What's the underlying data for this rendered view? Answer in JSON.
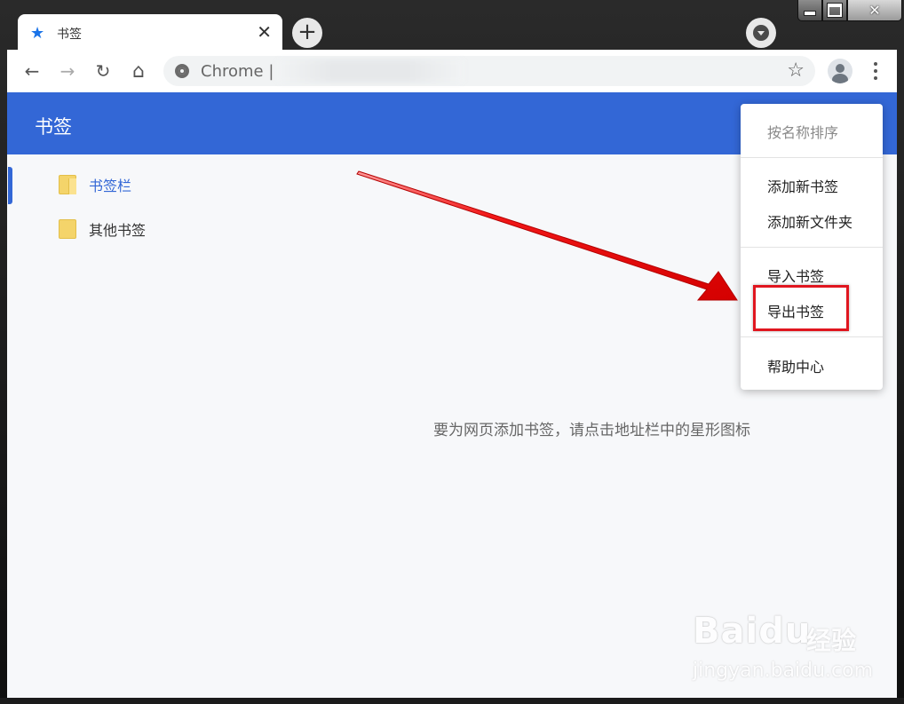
{
  "tab": {
    "title": "书签",
    "star_icon": "star-icon",
    "close_glyph": "✕"
  },
  "new_tab_glyph": "+",
  "window_controls": {
    "close_glyph": "✕"
  },
  "toolbar": {
    "back_glyph": "←",
    "forward_glyph": "→",
    "reload_glyph": "↻",
    "home_glyph": "⌂",
    "omnibox_text": "Chrome",
    "omnibox_separator": "|",
    "bookmark_star_glyph": "☆"
  },
  "page": {
    "title": "书签",
    "empty_message": "要为网页添加书签，请点击地址栏中的星形图标"
  },
  "sidebar": {
    "items": [
      {
        "label": "书签栏",
        "active": true
      },
      {
        "label": "其他书签",
        "active": false
      }
    ]
  },
  "menu": {
    "sort_by_name": "按名称排序",
    "add_bookmark": "添加新书签",
    "add_folder": "添加新文件夹",
    "import_bookmarks": "导入书签",
    "export_bookmarks": "导出书签",
    "help_center": "帮助中心"
  },
  "watermark": {
    "logo": "Baidu",
    "jingyan": "经验",
    "url": "jingyan.baidu.com"
  },
  "colors": {
    "accent": "#3367d6",
    "highlight": "#e0161f",
    "folder": "#f4d46a"
  }
}
